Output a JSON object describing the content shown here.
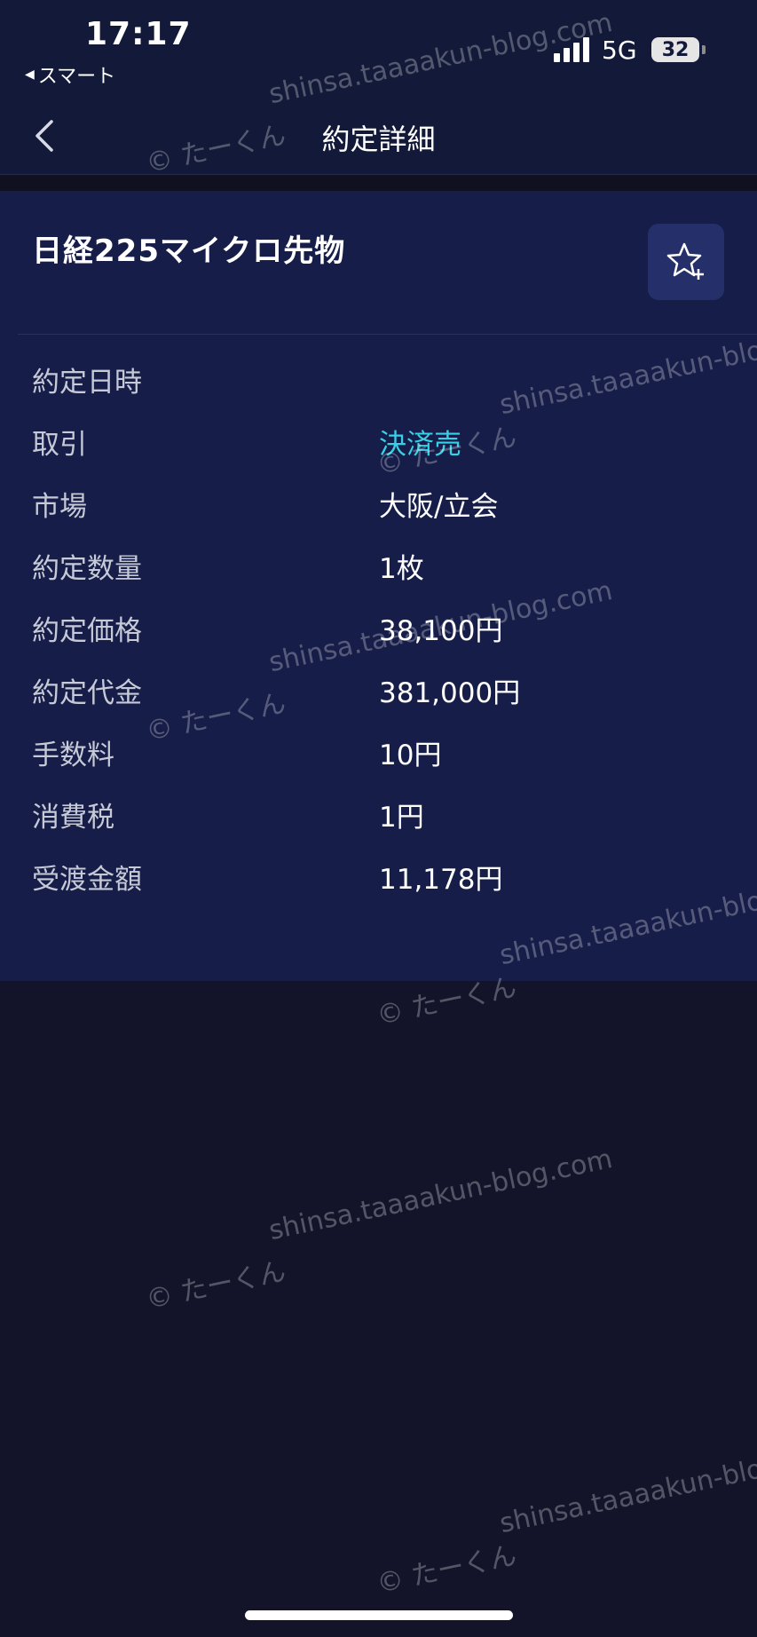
{
  "status_bar": {
    "time": "17:17",
    "back_app": "スマート",
    "network": "5G",
    "battery": "32"
  },
  "nav": {
    "title": "約定詳細"
  },
  "product": {
    "name": "日経225マイクロ先物"
  },
  "details": [
    {
      "label": "約定日時",
      "value": ""
    },
    {
      "label": "取引",
      "value": "決済売"
    },
    {
      "label": "市場",
      "value": "大阪/立会"
    },
    {
      "label": "約定数量",
      "value": "1枚"
    },
    {
      "label": "約定価格",
      "value": "38,100円"
    },
    {
      "label": "約定代金",
      "value": "381,000円"
    },
    {
      "label": "手数料",
      "value": "10円"
    },
    {
      "label": "消費税",
      "value": "1円"
    },
    {
      "label": "受渡金額",
      "value": "11,178円"
    }
  ],
  "colors": {
    "accent": "#36d1e6",
    "card_bg": "#161d48",
    "page_bg": "#13142a"
  },
  "watermark": {
    "site": "shinsa.taaaakun-blog.com",
    "author": "© たーくん"
  }
}
